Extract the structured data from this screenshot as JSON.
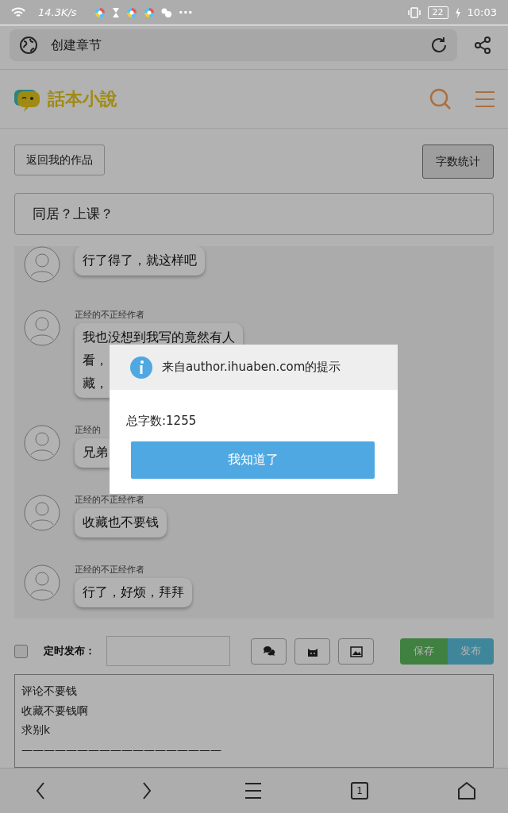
{
  "status_bar": {
    "speed": "14.3K/s",
    "more": "···",
    "battery": "22",
    "time": "10:03"
  },
  "address_bar": {
    "title": "创建章节"
  },
  "site_header": {
    "logo_text": "話本小說"
  },
  "toolbar": [
    {
      "label": "返回我的作品",
      "pressed": false
    },
    {
      "label": "字数统计",
      "pressed": true
    }
  ],
  "chapter_title": {
    "value": "同居？上课？"
  },
  "messages": [
    {
      "lines": [
        "行了得了，就这样吧"
      ]
    },
    {
      "name": "正经的不正经作者",
      "lines": [
        "我也没想到我写的竟然有人",
        "看，",
        "藏，"
      ]
    },
    {
      "name": "正经的",
      "lines": [
        "兄弟"
      ]
    },
    {
      "name": "正经的不正经作者",
      "lines": [
        "收藏也不要钱"
      ]
    },
    {
      "name": "正经的不正经作者",
      "lines": [
        "行了，好烦，拜拜"
      ]
    }
  ],
  "publish_bar": {
    "scheduled": {
      "label": "定时发布：",
      "checked": false
    },
    "insert_buttons": [
      {
        "kind": "chat"
      },
      {
        "kind": "cat"
      },
      {
        "kind": "image"
      }
    ],
    "save": "保存",
    "publish": "发布"
  },
  "editor": {
    "lines": [
      "评论不要钱",
      "收藏不要钱啊",
      "求别k",
      "——————————————————"
    ]
  },
  "dialog": {
    "title": "来自author.ihuaben.com的提示",
    "message": "总字数:1255",
    "button": "我知道了"
  },
  "nav_bar": {
    "tabs_count": "1"
  }
}
